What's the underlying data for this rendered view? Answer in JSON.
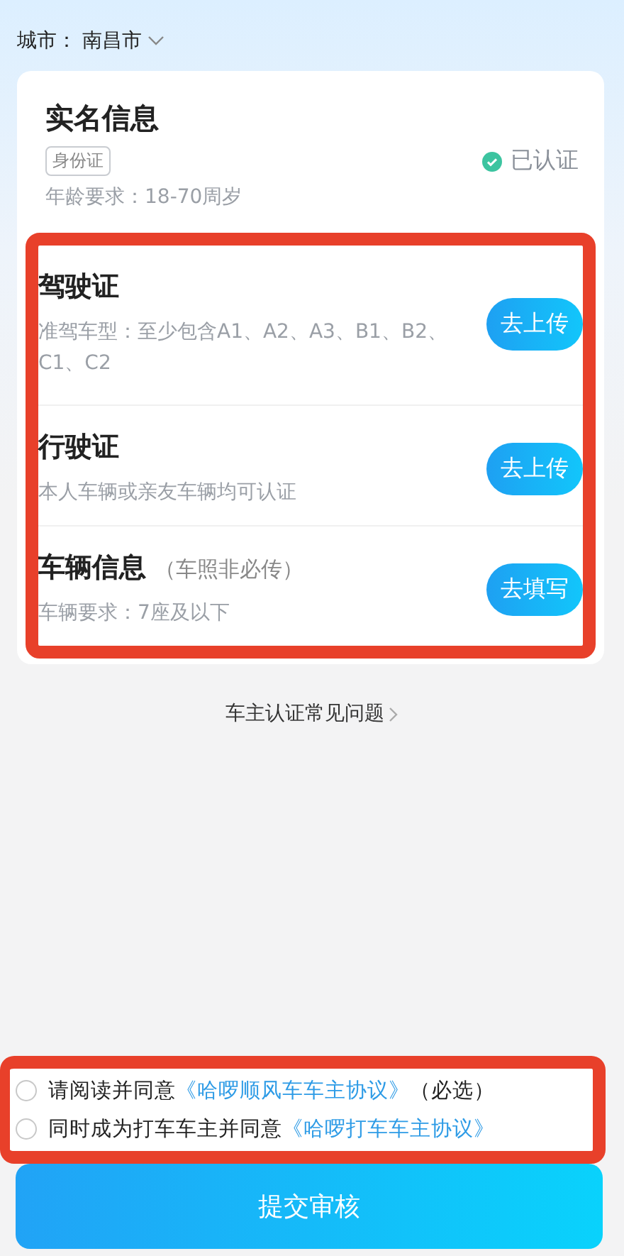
{
  "city": {
    "label": "城市：",
    "value": "南昌市"
  },
  "realname": {
    "title": "实名信息",
    "tag": "身份证",
    "verified": true,
    "status": "已认证",
    "requirement": "年龄要求：18-70周岁"
  },
  "items": [
    {
      "title": "驾驶证",
      "desc": "准驾车型：至少包含A1、A2、A3、B1、B2、C1、C2",
      "action": "去上传"
    },
    {
      "title": "行驶证",
      "desc": "本人车辆或亲友车辆均可认证",
      "action": "去上传"
    },
    {
      "title": "车辆信息",
      "note": "（车照非必传）",
      "desc": "车辆要求：7座及以下",
      "action": "去填写"
    }
  ],
  "faq": "车主认证常见问题",
  "agreements": [
    {
      "text": "请阅读并同意",
      "link": "《哈啰顺风车车主协议》",
      "suffix": "（必选）",
      "checked": false
    },
    {
      "text": "同时成为打车车主并同意",
      "link": "《哈啰打车车主协议》",
      "checked": false
    }
  ],
  "submit": "提交审核"
}
